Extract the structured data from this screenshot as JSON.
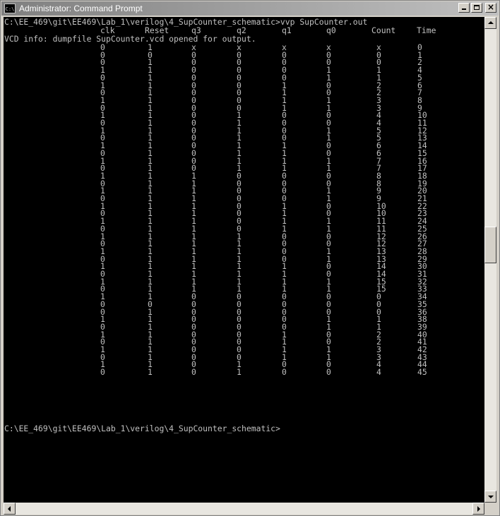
{
  "window": {
    "title": "Administrator: Command Prompt",
    "icon_label": "C:\\",
    "close_glyph": "×"
  },
  "console": {
    "command_line": "C:\\EE_469\\git\\EE469\\Lab_1\\verilog\\4_SupCounter_schematic>vvp SupCounter.out",
    "headers": [
      "clk",
      "Reset",
      "q3",
      "q2",
      "q1",
      "q0",
      "Count",
      "Time"
    ],
    "info_line": "VCD info: dumpfile SupCounter.vcd opened for output.",
    "rows": [
      [
        "0",
        "1",
        "x",
        "x",
        "x",
        "x",
        "x",
        "0"
      ],
      [
        "0",
        "0",
        "0",
        "0",
        "0",
        "0",
        "0",
        "1"
      ],
      [
        "0",
        "1",
        "0",
        "0",
        "0",
        "0",
        "0",
        "2"
      ],
      [
        "1",
        "1",
        "0",
        "0",
        "0",
        "1",
        "1",
        "4"
      ],
      [
        "0",
        "1",
        "0",
        "0",
        "0",
        "1",
        "1",
        "5"
      ],
      [
        "1",
        "1",
        "0",
        "0",
        "1",
        "0",
        "2",
        "6"
      ],
      [
        "0",
        "1",
        "0",
        "0",
        "1",
        "0",
        "2",
        "7"
      ],
      [
        "1",
        "1",
        "0",
        "0",
        "1",
        "1",
        "3",
        "8"
      ],
      [
        "0",
        "1",
        "0",
        "0",
        "1",
        "1",
        "3",
        "9"
      ],
      [
        "1",
        "1",
        "0",
        "1",
        "0",
        "0",
        "4",
        "10"
      ],
      [
        "0",
        "1",
        "0",
        "1",
        "0",
        "0",
        "4",
        "11"
      ],
      [
        "1",
        "1",
        "0",
        "1",
        "0",
        "1",
        "5",
        "12"
      ],
      [
        "0",
        "1",
        "0",
        "1",
        "0",
        "1",
        "5",
        "13"
      ],
      [
        "1",
        "1",
        "0",
        "1",
        "1",
        "0",
        "6",
        "14"
      ],
      [
        "0",
        "1",
        "0",
        "1",
        "1",
        "0",
        "6",
        "15"
      ],
      [
        "1",
        "1",
        "0",
        "1",
        "1",
        "1",
        "7",
        "16"
      ],
      [
        "0",
        "1",
        "0",
        "1",
        "1",
        "1",
        "7",
        "17"
      ],
      [
        "1",
        "1",
        "1",
        "0",
        "0",
        "0",
        "8",
        "18"
      ],
      [
        "0",
        "1",
        "1",
        "0",
        "0",
        "0",
        "8",
        "19"
      ],
      [
        "1",
        "1",
        "1",
        "0",
        "0",
        "1",
        "9",
        "20"
      ],
      [
        "0",
        "1",
        "1",
        "0",
        "0",
        "1",
        "9",
        "21"
      ],
      [
        "1",
        "1",
        "1",
        "0",
        "1",
        "0",
        "10",
        "22"
      ],
      [
        "0",
        "1",
        "1",
        "0",
        "1",
        "0",
        "10",
        "23"
      ],
      [
        "1",
        "1",
        "1",
        "0",
        "1",
        "1",
        "11",
        "24"
      ],
      [
        "0",
        "1",
        "1",
        "0",
        "1",
        "1",
        "11",
        "25"
      ],
      [
        "1",
        "1",
        "1",
        "1",
        "0",
        "0",
        "12",
        "26"
      ],
      [
        "0",
        "1",
        "1",
        "1",
        "0",
        "0",
        "12",
        "27"
      ],
      [
        "1",
        "1",
        "1",
        "1",
        "0",
        "1",
        "13",
        "28"
      ],
      [
        "0",
        "1",
        "1",
        "1",
        "0",
        "1",
        "13",
        "29"
      ],
      [
        "1",
        "1",
        "1",
        "1",
        "1",
        "0",
        "14",
        "30"
      ],
      [
        "0",
        "1",
        "1",
        "1",
        "1",
        "0",
        "14",
        "31"
      ],
      [
        "1",
        "1",
        "1",
        "1",
        "1",
        "1",
        "15",
        "32"
      ],
      [
        "0",
        "1",
        "1",
        "1",
        "1",
        "1",
        "15",
        "33"
      ],
      [
        "1",
        "1",
        "0",
        "0",
        "0",
        "0",
        "0",
        "34"
      ],
      [
        "0",
        "0",
        "0",
        "0",
        "0",
        "0",
        "0",
        "35"
      ],
      [
        "0",
        "1",
        "0",
        "0",
        "0",
        "0",
        "0",
        "36"
      ],
      [
        "1",
        "1",
        "0",
        "0",
        "0",
        "1",
        "1",
        "38"
      ],
      [
        "0",
        "1",
        "0",
        "0",
        "0",
        "1",
        "1",
        "39"
      ],
      [
        "1",
        "1",
        "0",
        "0",
        "1",
        "0",
        "2",
        "40"
      ],
      [
        "0",
        "1",
        "0",
        "0",
        "1",
        "0",
        "2",
        "41"
      ],
      [
        "1",
        "1",
        "0",
        "0",
        "1",
        "1",
        "3",
        "42"
      ],
      [
        "0",
        "1",
        "0",
        "0",
        "1",
        "1",
        "3",
        "43"
      ],
      [
        "1",
        "1",
        "0",
        "1",
        "0",
        "0",
        "4",
        "44"
      ],
      [
        "0",
        "1",
        "0",
        "1",
        "0",
        "0",
        "4",
        "45"
      ]
    ],
    "prompt_line": "C:\\EE_469\\git\\EE469\\Lab_1\\verilog\\4_SupCounter_schematic>"
  }
}
